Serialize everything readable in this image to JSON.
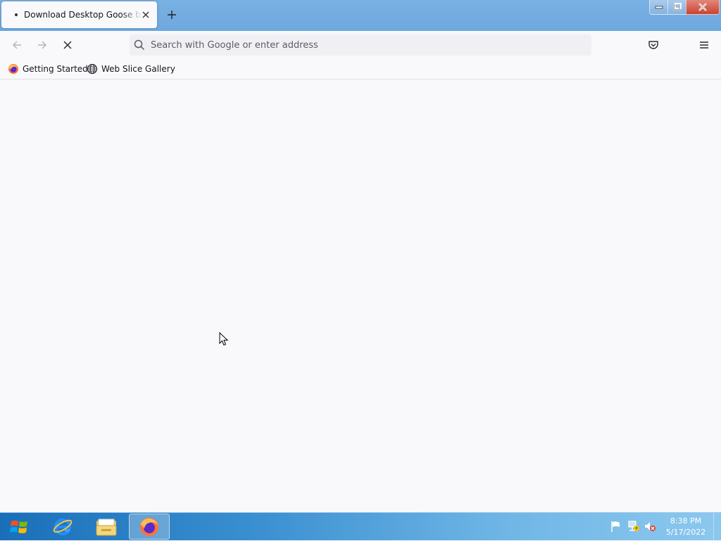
{
  "tab": {
    "title": "Download Desktop Goose by samperson"
  },
  "navbar": {
    "search_placeholder": "Search with Google or enter address"
  },
  "bookmarks": [
    {
      "label": "Getting Started"
    },
    {
      "label": "Web Slice Gallery"
    }
  ],
  "clock": {
    "time": "8:38 PM",
    "date": "5/17/2022"
  }
}
